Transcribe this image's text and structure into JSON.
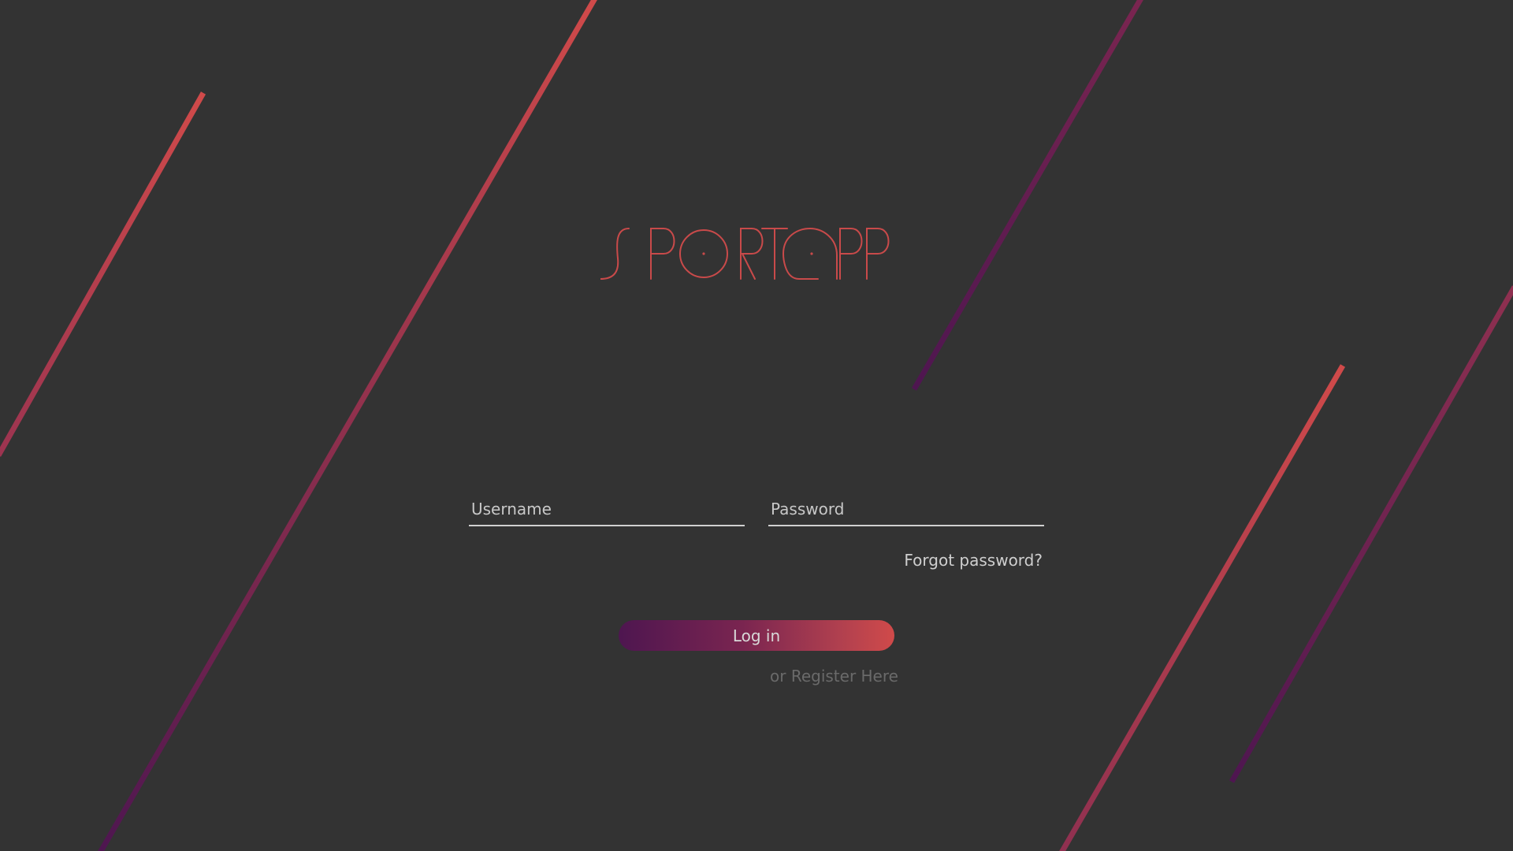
{
  "app": {
    "name": "SPORTAPP"
  },
  "colors": {
    "background": "#333333",
    "accent_red": "#d04a4a",
    "accent_purple": "#4e1650",
    "text_light": "#cfcfcf",
    "text_muted": "#6a6a6a"
  },
  "form": {
    "username_placeholder": "Username",
    "password_placeholder": "Password",
    "forgot_label": "Forgot password?",
    "login_label": "Log in",
    "register_label": "or Register Here"
  }
}
